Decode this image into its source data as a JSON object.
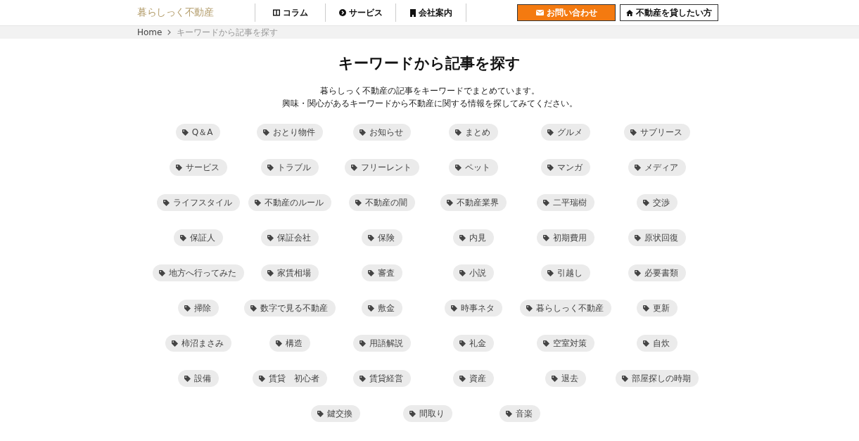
{
  "header": {
    "logo": "暮らしっく不動産",
    "nav": [
      {
        "label": "コラム"
      },
      {
        "label": "サービス"
      },
      {
        "label": "会社案内"
      }
    ],
    "buttons": [
      {
        "label": "お問い合わせ",
        "kind": "primary"
      },
      {
        "label": "不動産を貸したい方",
        "kind": "outline"
      }
    ]
  },
  "breadcrumb": [
    {
      "label": "Home",
      "kind": "link"
    },
    {
      "label": "キーワードから記事を探す",
      "kind": "current"
    }
  ],
  "title": "キーワードから記事を探す",
  "description": [
    "暮らしっく不動産の記事をキーワードでまとめています。",
    "興味・関心があるキーワードから不動産に関する情報を探してみてください。"
  ],
  "tags": [
    "Q＆A",
    "おとり物件",
    "お知らせ",
    "まとめ",
    "グルメ",
    "サブリース",
    "サービス",
    "トラブル",
    "フリーレント",
    "ペット",
    "マンガ",
    "メディア",
    "ライフスタイル",
    "不動産のルール",
    "不動産の闇",
    "不動産業界",
    "二平瑞樹",
    "交渉",
    "保証人",
    "保証会社",
    "保険",
    "内見",
    "初期費用",
    "原状回復",
    "地方へ行ってみた",
    "家賃相場",
    "審査",
    "小説",
    "引越し",
    "必要書類",
    "掃除",
    "数字で見る不動産",
    "敷金",
    "時事ネタ",
    "暮らしっく不動産",
    "更新",
    "柿沼まさみ",
    "構造",
    "用語解説",
    "礼金",
    "空室対策",
    "自炊",
    "設備",
    "賃貸　初心者",
    "賃貸経営",
    "資産",
    "退去",
    "部屋探しの時期",
    "鍵交換",
    "間取り",
    "音楽"
  ]
}
